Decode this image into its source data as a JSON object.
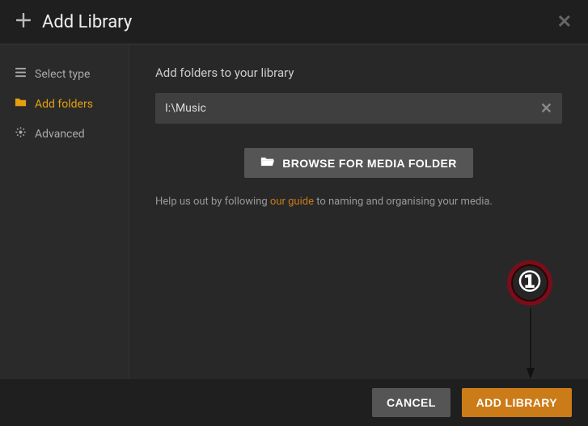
{
  "header": {
    "title": "Add Library"
  },
  "sidebar": {
    "items": [
      {
        "label": "Select type"
      },
      {
        "label": "Add folders"
      },
      {
        "label": "Advanced"
      }
    ]
  },
  "main": {
    "heading": "Add folders to your library",
    "folder_path": "I:\\Music",
    "browse_label": "BROWSE FOR MEDIA FOLDER",
    "help_pre": "Help us out by following ",
    "help_link": "our guide",
    "help_post": " to naming and organising your media."
  },
  "footer": {
    "cancel": "CANCEL",
    "submit": "ADD LIBRARY"
  },
  "annotation": {
    "number": "①"
  }
}
